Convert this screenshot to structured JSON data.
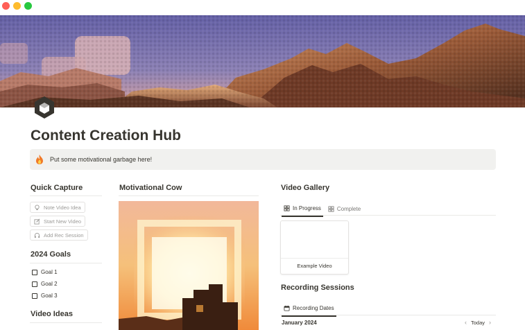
{
  "window": {
    "controls": [
      "close",
      "minimize",
      "zoom"
    ]
  },
  "page": {
    "title": "Content Creation Hub",
    "icon": "hexagon-cube-icon"
  },
  "callout": {
    "icon": "fire-icon",
    "text": "Put some motivational garbage here!"
  },
  "quick_capture": {
    "title": "Quick Capture",
    "buttons": [
      {
        "label": "Note Video Idea",
        "icon": "lightbulb-icon"
      },
      {
        "label": "Start New Video",
        "icon": "edit-icon"
      },
      {
        "label": "Add Rec Session",
        "icon": "headphones-icon"
      }
    ]
  },
  "goals": {
    "title": "2024 Goals",
    "items": [
      {
        "label": "Goal 1",
        "checked": false
      },
      {
        "label": "Goal 2",
        "checked": false
      },
      {
        "label": "Goal 3",
        "checked": false
      }
    ]
  },
  "video_ideas": {
    "title": "Video Ideas"
  },
  "motivational_cow": {
    "title": "Motivational Cow"
  },
  "video_gallery": {
    "title": "Video Gallery",
    "tabs": [
      {
        "label": "In Progress",
        "active": true,
        "icon": "gallery-grid-icon"
      },
      {
        "label": "Complete",
        "active": false,
        "icon": "gallery-grid-icon"
      }
    ],
    "cards": [
      {
        "title": "Example Video"
      }
    ]
  },
  "recording_sessions": {
    "title": "Recording Sessions",
    "tabs": [
      {
        "label": "Recording Dates",
        "active": true,
        "icon": "calendar-icon"
      }
    ],
    "month": "January 2024",
    "today_label": "Today"
  },
  "colors": {
    "text": "#37352f",
    "muted": "#9b9a97",
    "callout_bg": "#f1f1ef",
    "divider": "#e9e9e7",
    "sky": "#6f6bab",
    "terrain_lit": "#c9865a",
    "terrain_dark": "#5a3322"
  }
}
